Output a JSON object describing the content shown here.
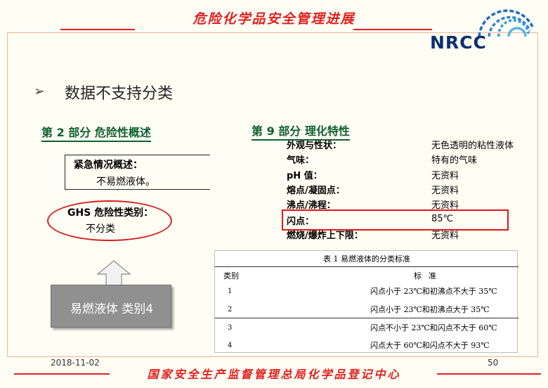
{
  "header": {
    "title": "危险化学品安全管理进展",
    "logo_text": "NRCC",
    "accent_color": "#e0201e",
    "logo_color": "#0a2f6e"
  },
  "bullet": {
    "icon": "arrow-bullet-icon",
    "text": "数据不支持分类"
  },
  "section2": {
    "title": "第 2 部分   危险性概述",
    "emergency_label": "紧急情况概述：",
    "emergency_value": "不易燃液体。",
    "ghs_label": "GHS 危险性类别：",
    "ghs_value": "不分类",
    "category_box": "易燃液体 类别4",
    "title_color": "#0f5f2f"
  },
  "section9": {
    "title": "第 9 部分   理化特性",
    "properties": [
      {
        "key": "外观与性状：",
        "value": "无色透明的粘性液体"
      },
      {
        "key": "气味：",
        "value": "特有的气味"
      },
      {
        "key": "pH 值：",
        "value": "无资料"
      },
      {
        "key": "熔点/凝固点：",
        "value": "无资料"
      },
      {
        "key": "沸点/沸程：",
        "value": "无资料"
      },
      {
        "key": "闪点：",
        "value": "85℃"
      },
      {
        "key": "燃烧/爆炸上下限：",
        "value": "无资料"
      }
    ]
  },
  "table": {
    "caption": "表 1      易燃液体的分类标准",
    "header_category": "类别",
    "header_standard": "标准",
    "rows": [
      {
        "category": "1",
        "standard": "闪点小于 23℃和初沸点不大于 35℃"
      },
      {
        "category": "2",
        "standard": "闪点小于 23℃和初沸点大于 35℃"
      },
      {
        "category": "3",
        "standard": "闪点不小于 23℃和闪点不大于 60℃"
      },
      {
        "category": "4",
        "standard": "闪点大于 60℃和闪点不大于 93℃"
      }
    ]
  },
  "footer": {
    "date": "2018-11-02",
    "page": "50",
    "org": "国家安全生产监督管理总局化学品登记中心"
  }
}
